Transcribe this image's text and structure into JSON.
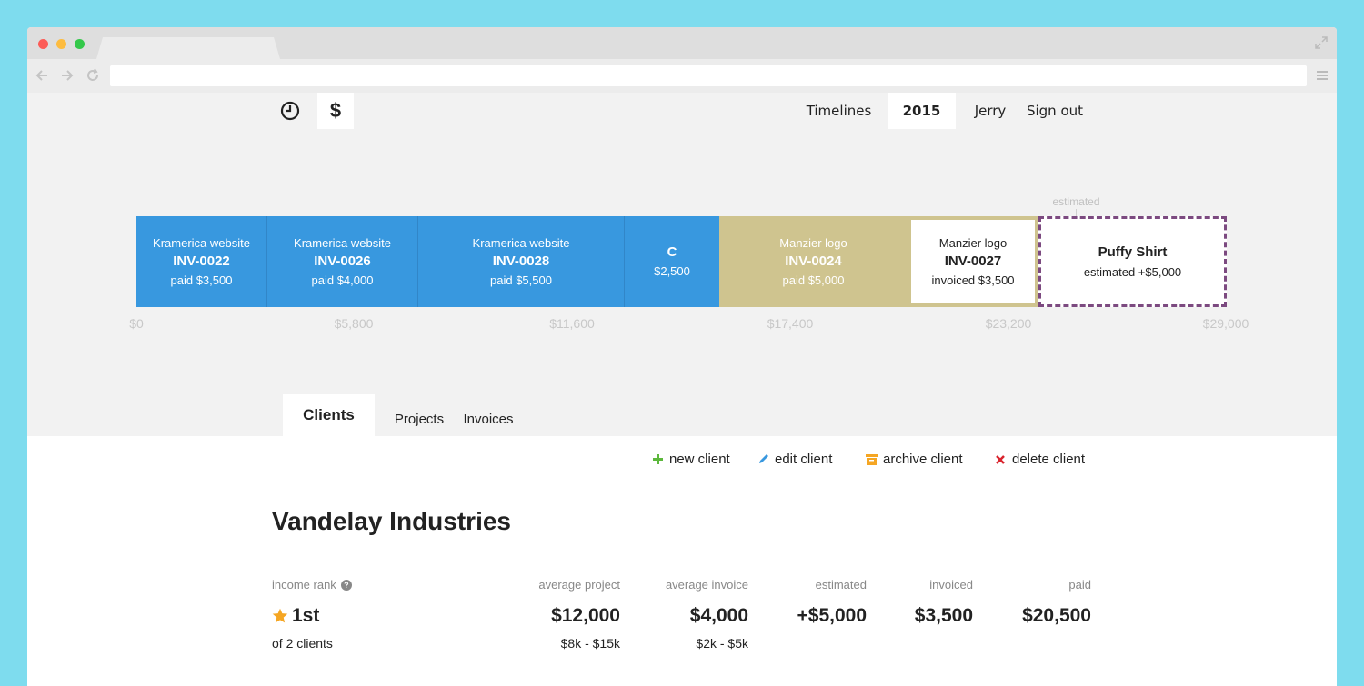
{
  "colors": {
    "background": "#7edcee",
    "paid": "#3898df",
    "paid_alt": "#cfc48f",
    "estimated_border": "#7c4a80",
    "add": "#5cb83c",
    "edit": "#3898df",
    "archive": "#f5a623",
    "delete": "#d9232d",
    "star": "#f5a623"
  },
  "header": {
    "icons": [
      "clock-icon",
      "dollar-icon"
    ],
    "dollar_symbol": "$",
    "nav": [
      "Timelines",
      "2015",
      "Jerry",
      "Sign out"
    ]
  },
  "timeline": {
    "estimated_label": "estimated",
    "segments": [
      {
        "title": "Kramerica website",
        "invoice": "INV-0022",
        "amount": "paid $3,500",
        "status": "paid"
      },
      {
        "title": "Kramerica website",
        "invoice": "INV-0026",
        "amount": "paid $4,000",
        "status": "paid"
      },
      {
        "title": "Kramerica website",
        "invoice": "INV-0028",
        "amount": "paid $5,500",
        "status": "paid"
      },
      {
        "title": "C",
        "invoice": "",
        "amount": "$2,500",
        "status": "paid"
      },
      {
        "title": "Manzier logo",
        "invoice": "INV-0024",
        "amount": "paid $5,000",
        "status": "paid"
      },
      {
        "title": "Manzier logo",
        "invoice": "INV-0027",
        "amount": "invoiced $3,500",
        "status": "invoiced"
      },
      {
        "title": "Puffy Shirt",
        "invoice": "",
        "amount": "estimated +$5,000",
        "status": "estimated"
      }
    ],
    "axis": [
      "$0",
      "$5,800",
      "$11,600",
      "$17,400",
      "$23,200",
      "$29,000"
    ]
  },
  "tabs": [
    "Clients",
    "Projects",
    "Invoices"
  ],
  "actions": [
    {
      "label": "new client",
      "icon": "plus-icon"
    },
    {
      "label": "edit client",
      "icon": "pencil-icon"
    },
    {
      "label": "archive client",
      "icon": "archive-icon"
    },
    {
      "label": "delete client",
      "icon": "x-icon"
    }
  ],
  "client": {
    "name": "Vandelay Industries",
    "income_rank": {
      "label": "income rank",
      "value": "1st",
      "sub": "of 2 clients",
      "icon": "star-icon",
      "help_icon": "question-icon"
    },
    "stats": [
      {
        "label": "average project",
        "value": "$12,000",
        "sub": "$8k - $15k"
      },
      {
        "label": "average invoice",
        "value": "$4,000",
        "sub": "$2k - $5k"
      },
      {
        "label": "estimated",
        "value": "+$5,000",
        "sub": ""
      },
      {
        "label": "invoiced",
        "value": "$3,500",
        "sub": ""
      },
      {
        "label": "paid",
        "value": "$20,500",
        "sub": ""
      }
    ]
  }
}
